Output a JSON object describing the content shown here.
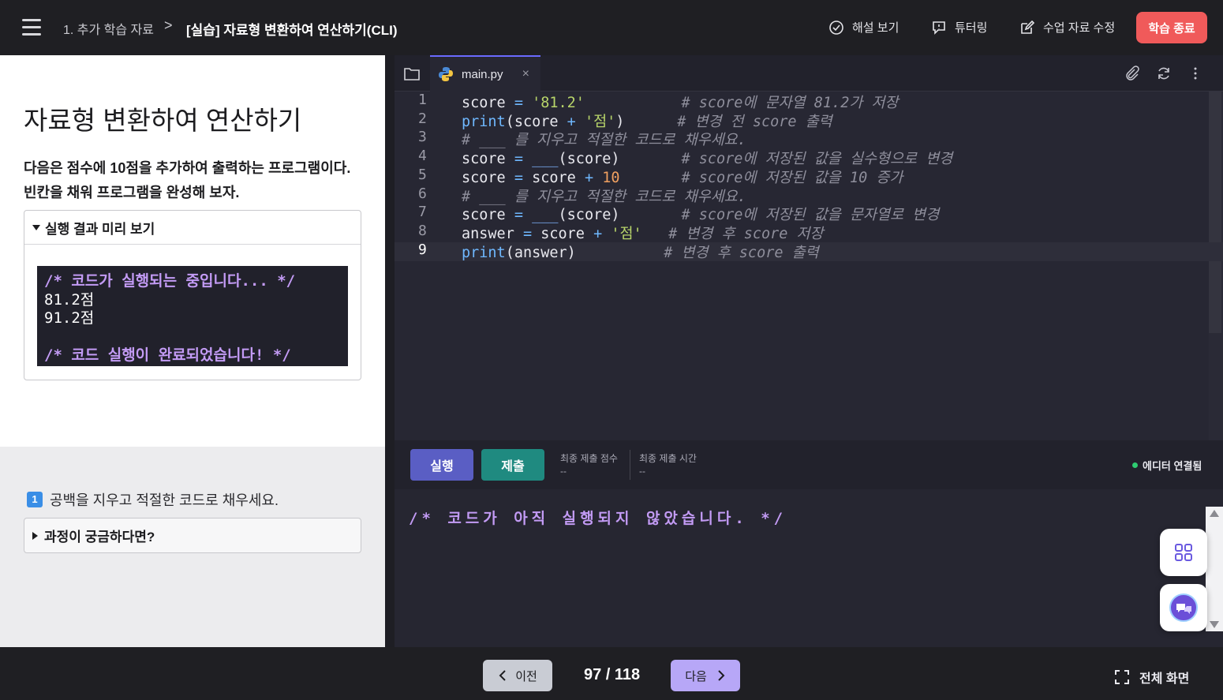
{
  "header": {
    "breadcrumb_parent": "1. 추가 학습 자료",
    "breadcrumb_sep": ">",
    "breadcrumb_current": "[실습] 자료형 변환하여 연산하기(CLI)",
    "actions": {
      "solution": "해설 보기",
      "tutoring": "튜터링",
      "edit_material": "수업 자료 수정"
    },
    "end_button": "학습 종료",
    "end_color": "#f05a5a"
  },
  "lesson": {
    "title": "자료형 변환하여 연산하기",
    "description": "다음은 점수에 10점을 추가하여 출력하는 프로그램이다. 빈칸을 채워 프로그램을 완성해 보자.",
    "preview_label": "실행 결과 미리 보기",
    "preview_lines": [
      {
        "text": "/* 코드가 실행되는 중입니다... */",
        "kind": "comment"
      },
      {
        "text": "81.2점",
        "kind": "out"
      },
      {
        "text": "91.2점",
        "kind": "out"
      },
      {
        "text": " ",
        "kind": "out"
      },
      {
        "text": "/* 코드 실행이 완료되었습니다! */",
        "kind": "comment"
      }
    ],
    "step_badge": "1",
    "step_text": "공백을 지우고 적절한 코드로 채우세요.",
    "process_label": "과정이 궁금하다면?"
  },
  "editor": {
    "tab_name": "main.py",
    "tab_close": "×",
    "current_line": 9,
    "lines": [
      {
        "n": "1",
        "parts": [
          [
            "score ",
            ""
          ],
          [
            "=",
            "op"
          ],
          [
            " ",
            ""
          ],
          [
            "'81.2'",
            "str"
          ],
          [
            "           ",
            ""
          ],
          [
            "# score에 문자열 81.2가 저장",
            "cm"
          ]
        ]
      },
      {
        "n": "2",
        "parts": [
          [
            "print",
            "fn"
          ],
          [
            "(score ",
            ""
          ],
          [
            "+",
            "op"
          ],
          [
            " ",
            ""
          ],
          [
            "'점'",
            "str"
          ],
          [
            ")      ",
            ""
          ],
          [
            "# 변경 전 score 출력",
            "cm"
          ]
        ]
      },
      {
        "n": "3",
        "parts": [
          [
            "# ___ 를 지우고 적절한 코드로 채우세요.",
            "cm"
          ]
        ]
      },
      {
        "n": "4",
        "parts": [
          [
            "score ",
            ""
          ],
          [
            "=",
            "op"
          ],
          [
            " ",
            ""
          ],
          [
            "___",
            "blank"
          ],
          [
            "(score)       ",
            ""
          ],
          [
            "# score에 저장된 값을 실수형으로 변경",
            "cm"
          ]
        ]
      },
      {
        "n": "5",
        "parts": [
          [
            "score ",
            ""
          ],
          [
            "=",
            "op"
          ],
          [
            " score ",
            ""
          ],
          [
            "+",
            "op"
          ],
          [
            " ",
            ""
          ],
          [
            "10",
            "num"
          ],
          [
            "       ",
            ""
          ],
          [
            "# score에 저장된 값을 10 증가",
            "cm"
          ]
        ]
      },
      {
        "n": "6",
        "parts": [
          [
            "# ___ 를 지우고 적절한 코드로 채우세요.",
            "cm"
          ]
        ]
      },
      {
        "n": "7",
        "parts": [
          [
            "score ",
            ""
          ],
          [
            "=",
            "op"
          ],
          [
            " ",
            ""
          ],
          [
            "___",
            "blank"
          ],
          [
            "(score)       ",
            ""
          ],
          [
            "# score에 저장된 값을 문자열로 변경",
            "cm"
          ]
        ]
      },
      {
        "n": "8",
        "parts": [
          [
            "answer ",
            ""
          ],
          [
            "=",
            "op"
          ],
          [
            " score ",
            ""
          ],
          [
            "+",
            "op"
          ],
          [
            " ",
            ""
          ],
          [
            "'점'",
            "str"
          ],
          [
            "   ",
            ""
          ],
          [
            "# 변경 후 score 저장",
            "cm"
          ]
        ]
      },
      {
        "n": "9",
        "parts": [
          [
            "print",
            "fn"
          ],
          [
            "(answer)          ",
            ""
          ],
          [
            "# 변경 후 score 출력",
            "cm"
          ]
        ]
      }
    ]
  },
  "runbar": {
    "run_label": "실행",
    "submit_label": "제출",
    "run_color": "#5a5ec4",
    "submit_color": "#1f8a80",
    "last_score_label": "최종 제출 점수",
    "last_score_value": "--",
    "last_time_label": "최종 제출 시간",
    "last_time_value": "--",
    "status": "에디터 연결됨",
    "status_color": "#2ecc71"
  },
  "console": {
    "text": "/* 코드가 아직 실행되지 않았습니다. */"
  },
  "footer": {
    "prev_label": "이전",
    "page_indicator": "97 / 118",
    "next_label": "다음",
    "fullscreen_label": "전체 화면"
  }
}
